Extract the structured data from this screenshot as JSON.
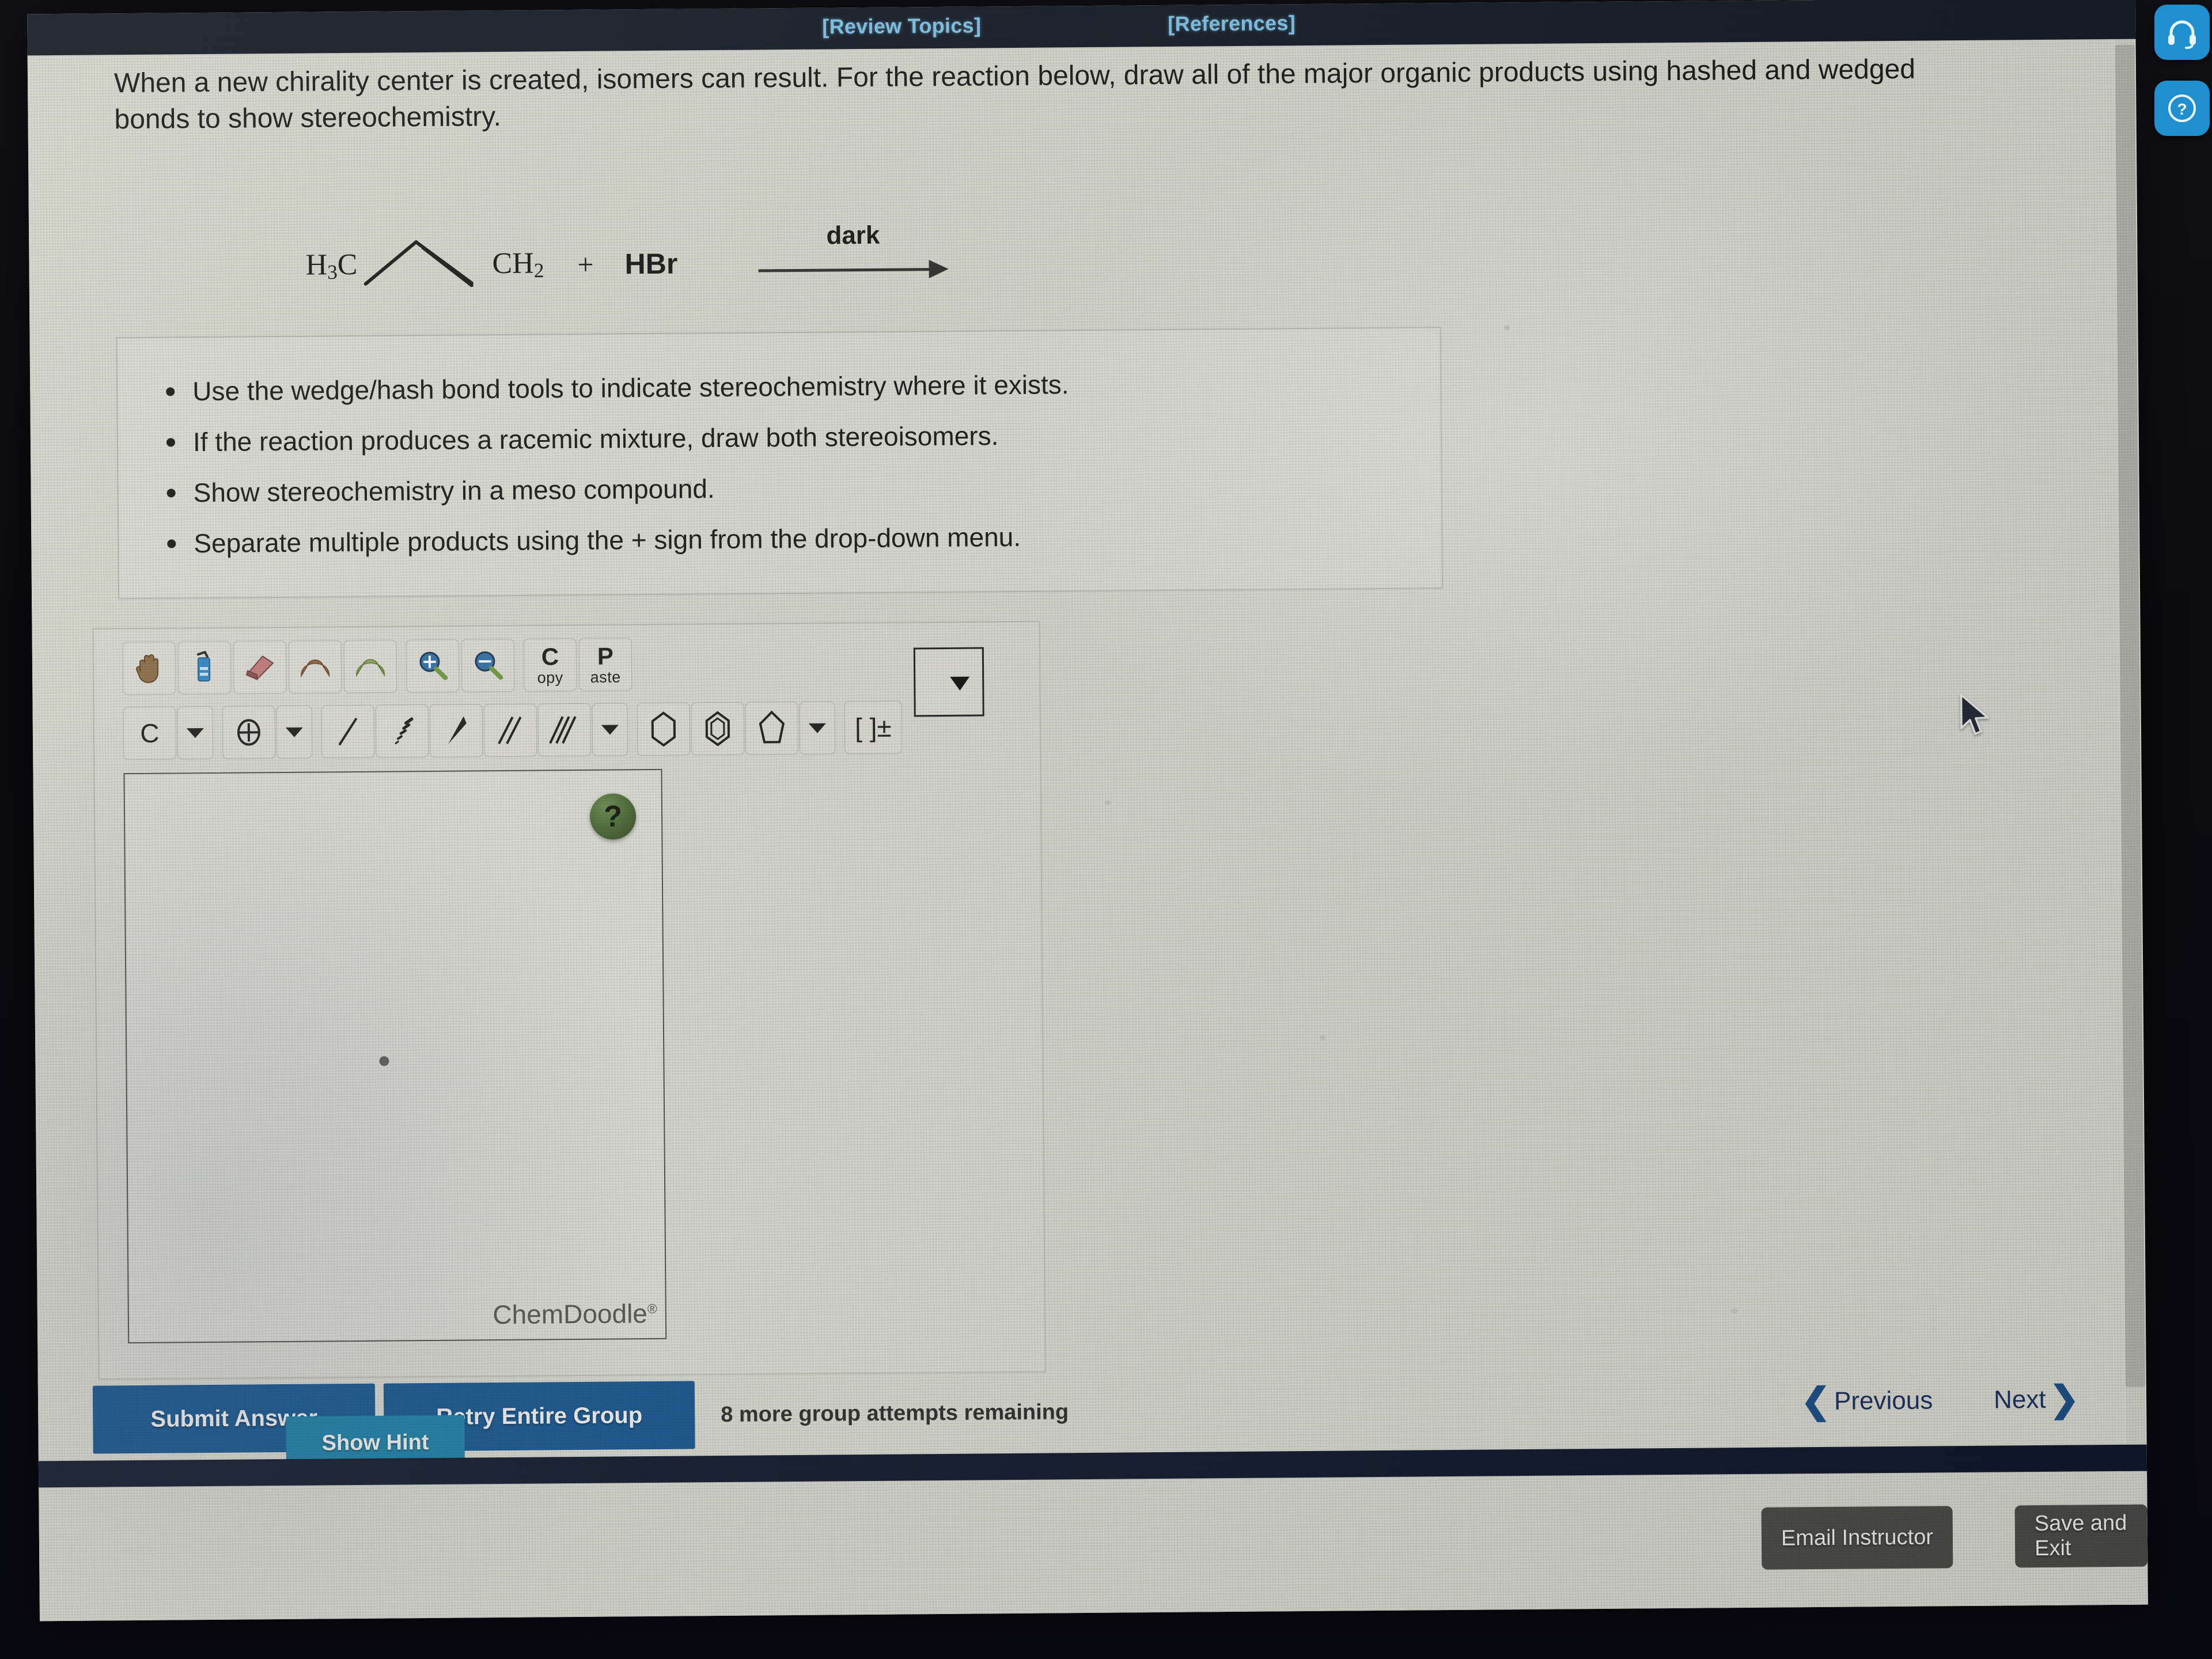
{
  "topbar": {
    "review_topics": "[Review Topics]",
    "references": "[References]"
  },
  "prompt": "When a new chirality center is created, isomers can result. For the reaction below, draw all of the major organic products using hashed and wedged bonds to show stereochemistry.",
  "reaction": {
    "reactant_left_label": "H3C",
    "reactant_left_label_html": "H₃C",
    "reactant_right_label": "CH2",
    "reactant_right_label_html": "CH₂",
    "plus": "+",
    "reagent": "HBr",
    "condition": "dark",
    "arrow": "reaction-arrow-right"
  },
  "instructions": [
    "Use the wedge/hash bond tools to indicate stereochemistry where it exists.",
    "If the reaction produces a racemic mixture, draw both stereoisomers.",
    "Show stereochemistry in a meso compound.",
    "Separate multiple products using the + sign from the drop-down menu."
  ],
  "sketcher": {
    "toolbar_row1": [
      {
        "name": "pan-hand-icon",
        "glyph": "✋"
      },
      {
        "name": "lasso-select-icon",
        "glyph": "⬚"
      },
      {
        "name": "eraser-icon",
        "glyph": "▰"
      },
      {
        "name": "undo-icon",
        "glyph": "↶"
      },
      {
        "name": "redo-icon",
        "glyph": "↷"
      },
      {
        "name": "zoom-in-icon",
        "glyph": "⊕"
      },
      {
        "name": "zoom-out-icon",
        "glyph": "⊖"
      }
    ],
    "copy_label_big": "C",
    "copy_label_rest": "opy",
    "paste_label_big": "P",
    "paste_label_rest": "aste",
    "element_label": "C",
    "charge_glyph": "⊕",
    "bracket_label": "[ ]±",
    "bond_tools": [
      "single-bond",
      "hashed-bond",
      "wedge-bond",
      "double-bond",
      "triple-bond"
    ],
    "ring_tools": [
      "cyclohexane-ring",
      "benzene-ring",
      "cyclopentane-ring"
    ],
    "canvas": {
      "help_label": "?",
      "watermark": "ChemDoodle",
      "watermark_mark": "®"
    },
    "dropdown_value": ""
  },
  "actions": {
    "submit": "Submit Answer",
    "retry": "Retry Entire Group",
    "hint": "Show Hint",
    "attempts": "8 more group attempts remaining",
    "previous": "Previous",
    "next": "Next",
    "prev_chevron": "❮",
    "next_chevron": "❯"
  },
  "footer": {
    "email_instructor": "Email Instructor",
    "save_and_exit": "Save and Exit"
  },
  "side_widgets": [
    {
      "name": "support-headset-icon"
    },
    {
      "name": "help-question-icon"
    }
  ],
  "colors": {
    "topbar_bg": "#111823",
    "topbar_link": "#7fc4e8",
    "page_bg": "#d6d7ce",
    "primary_button": "#14548e",
    "hint_button": "#1a7fa5",
    "dark_button": "#4a4a48",
    "nav_link": "#1d4f86",
    "canvas_help": "#4c6b35"
  }
}
